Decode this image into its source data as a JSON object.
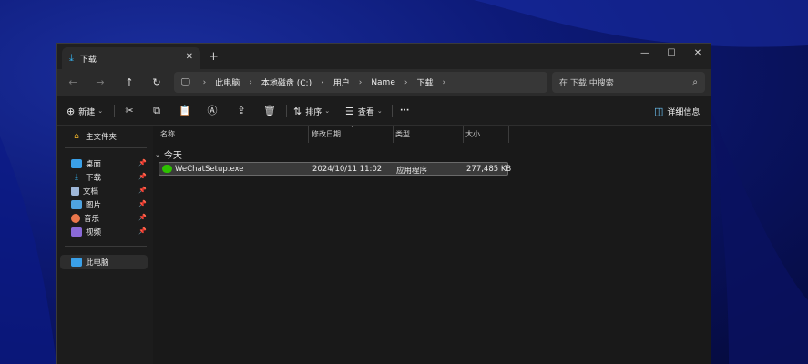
{
  "tab": {
    "title": "下载"
  },
  "window_controls": {
    "minimize": "—",
    "maximize": "☐",
    "close": "✕"
  },
  "breadcrumb": [
    "此电脑",
    "本地磁盘 (C:)",
    "用户",
    "Name",
    "下载"
  ],
  "search": {
    "placeholder": "在 下载 中搜索"
  },
  "toolbar": {
    "new_label": "新建",
    "sort_label": "排序",
    "view_label": "查看",
    "more_label": "···",
    "details_label": "详细信息"
  },
  "sidebar": {
    "home": "主文件夹",
    "quick": [
      {
        "label": "桌面",
        "icon": "desktop-icon",
        "color": "#3aa0e8"
      },
      {
        "label": "下载",
        "icon": "download-icon",
        "color": "#35b3f0"
      },
      {
        "label": "文档",
        "icon": "document-icon",
        "color": "#9fb7d8"
      },
      {
        "label": "图片",
        "icon": "pictures-icon",
        "color": "#4fa3e0"
      },
      {
        "label": "音乐",
        "icon": "music-icon",
        "color": "#e9764b"
      },
      {
        "label": "视频",
        "icon": "video-icon",
        "color": "#8a6ad8"
      }
    ],
    "this_pc": "此电脑"
  },
  "columns": {
    "name": "名称",
    "modified": "修改日期",
    "type": "类型",
    "size": "大小"
  },
  "group": {
    "label": "今天"
  },
  "files": [
    {
      "name": "WeChatSetup.exe",
      "modified": "2024/10/11 11:02",
      "type": "应用程序",
      "size": "277,485 KB"
    }
  ]
}
